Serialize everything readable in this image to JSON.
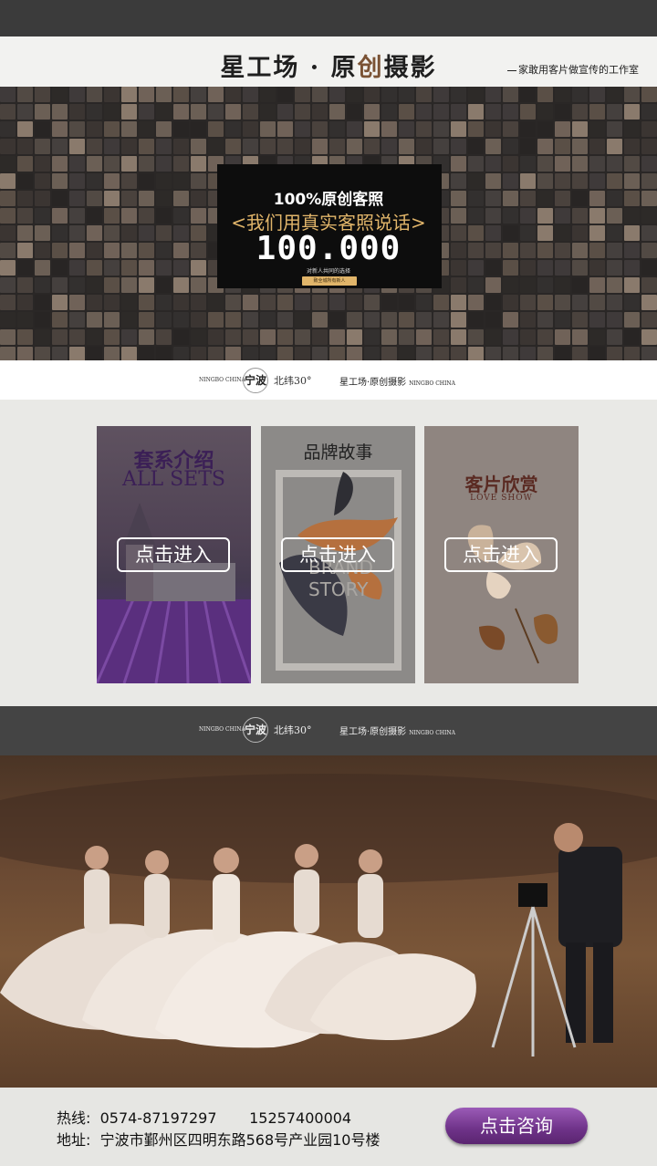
{
  "header": {
    "brand_title_part1": "星工场 · 原",
    "brand_title_accent": "创",
    "brand_title_part2": "摄影",
    "tagline": "家敢用客片做宣传的工作室"
  },
  "promo": {
    "line1_prefix": "100%",
    "line1_text": "原创客照",
    "line2": "<我们用真实客照说话>",
    "number": "100.000",
    "note": "对新人共同的选择",
    "chip": "致全城所有新人"
  },
  "logo_strip": {
    "en_left": "NINGBO CHINA",
    "city": "宁波",
    "latitude": "北纬30°",
    "brand": "星工场·原创摄影",
    "en_right": "NINGBO CHINA"
  },
  "cards": [
    {
      "title_cn": "套系介绍",
      "title_en": "ALL SETS",
      "button": "点击进入"
    },
    {
      "title_cn": "品牌故事",
      "title_en": "BRAND STORY",
      "button": "点击进入"
    },
    {
      "title_cn": "客片欣赏",
      "title_en": "LOVE SHOW",
      "button": "点击进入"
    }
  ],
  "footer": {
    "hotline_label": "热线:",
    "hotline_1": "0574-87197297",
    "hotline_2": "15257400004",
    "address_label": "地址:",
    "address": "宁波市鄞州区四明东路568号产业园10号楼",
    "consult_button": "点击咨询"
  },
  "colors": {
    "accent_gold": "#e1b56a",
    "brand_brown": "#7a5234",
    "button_purple": "#6e3288"
  }
}
